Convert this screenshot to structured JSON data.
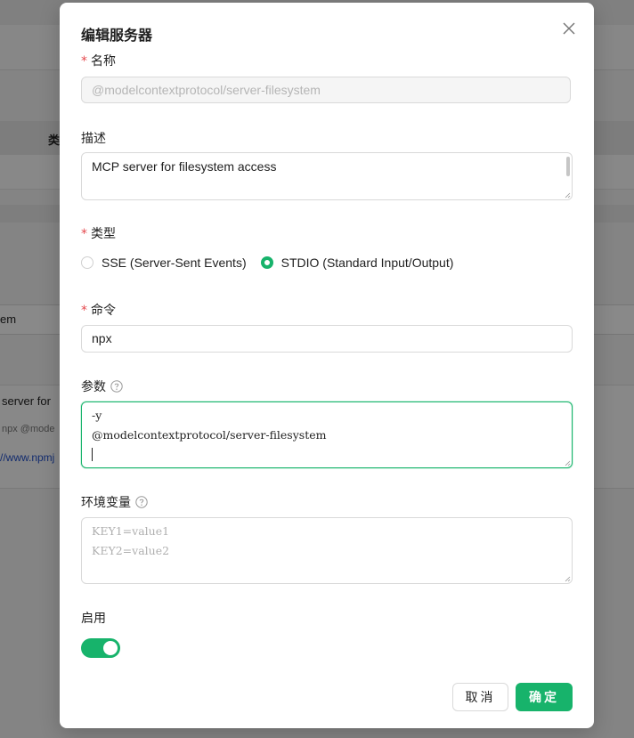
{
  "background": {
    "col_header": "类",
    "row_fragment": "em",
    "desc_fragment": " server for",
    "cmd_fragment": "npx @mode",
    "link_fragment": "//www.npmj"
  },
  "dialog": {
    "title": "编辑服务器",
    "required_mark": "*",
    "name": {
      "label": "名称",
      "value": "@modelcontextprotocol/server-filesystem"
    },
    "description": {
      "label": "描述",
      "value": "MCP server for filesystem access"
    },
    "type": {
      "label": "类型",
      "options": [
        {
          "label": "SSE (Server-Sent Events)",
          "checked": false
        },
        {
          "label": "STDIO (Standard Input/Output)",
          "checked": true
        }
      ]
    },
    "command": {
      "label": "命令",
      "value": "npx"
    },
    "args": {
      "label": "参数",
      "lines": [
        "-y",
        "@modelcontextprotocol/server-filesystem"
      ]
    },
    "env": {
      "label": "环境变量",
      "placeholder_lines": [
        "KEY1=value1",
        "KEY2=value2"
      ]
    },
    "enabled": {
      "label": "启用",
      "on": true
    },
    "buttons": {
      "cancel": "取消",
      "ok": "确定"
    }
  },
  "colors": {
    "accent": "#17b36b",
    "required": "#e5484d"
  },
  "icons": {
    "close": "close-icon",
    "help": "question-circle-icon"
  }
}
